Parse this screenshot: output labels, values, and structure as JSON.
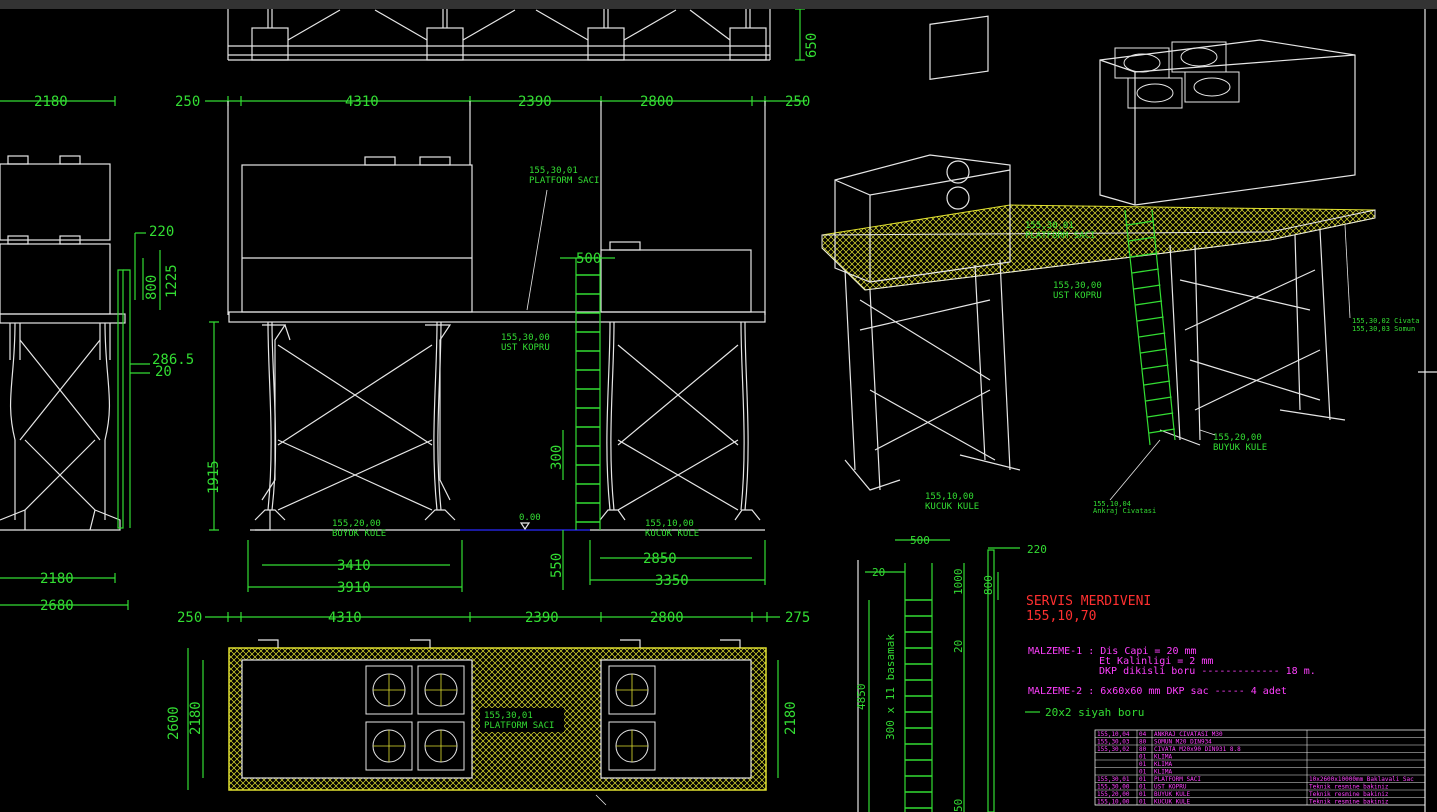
{
  "colors": {
    "background": "#000000",
    "lines": "#e6e6e6",
    "dimensions": "#33dd33",
    "hatch": "#e0e030",
    "title": "#ff3030",
    "materials": "#ff40ff",
    "groundline": "#2a2aff"
  },
  "top_view_partial": {
    "dim_650": "650"
  },
  "left_view": {
    "dim_top": "2180",
    "dim_220": "220",
    "dim_800": "800",
    "dim_1225": "1225",
    "dim_2865": "286.5",
    "dim_20": "20",
    "dim_bottom_2180": "2180",
    "dim_bottom_2680": "2680"
  },
  "front_view": {
    "dim_250_left": "250",
    "dim_4310": "4310",
    "dim_2390": "2390",
    "dim_2800": "2800",
    "dim_250_right": "250",
    "dim_500": "500",
    "dim_1915": "1915",
    "dim_300": "300",
    "dim_550": "550",
    "dim_3410": "3410",
    "dim_3910": "3910",
    "dim_2850": "2850",
    "dim_3350": "3350",
    "level_000": "0.00",
    "label_platform_code": "155,30,01",
    "label_platform_name": "PLATFORM SACI",
    "label_bridge_code": "155,30,00",
    "label_bridge_name": "UST KOPRU",
    "label_big_code": "155,20,00",
    "label_big_name": "BUYUK KULE",
    "label_small_code": "155,10,00",
    "label_small_name": "KUCUK KULE"
  },
  "plan_view": {
    "dim_250": "250",
    "dim_4310": "4310",
    "dim_2390": "2390",
    "dim_2800": "2800",
    "dim_275": "275",
    "dim_2600": "2600",
    "dim_2180_left": "2180",
    "dim_2180_right": "2180",
    "label_platform_code": "155,30,01",
    "label_platform_name": "PLATFORM SACI"
  },
  "iso_view": {
    "label_platform_code": "155,30,01",
    "label_platform_name": "PLATFORM SACI",
    "label_bridge_code": "155,30,00",
    "label_bridge_name": "UST KOPRU",
    "label_small_code": "155,10,00",
    "label_small_name": "KUCUK KULE",
    "label_big_code": "155,20,00",
    "label_big_name": "BUYUK KULE",
    "label_anchor_code": "155,10,04",
    "label_anchor_name": "Ankraj Civatasi",
    "label_bolt_codes": "155,30,02  Civata",
    "label_nut_codes": "155,30,03  Somun"
  },
  "ladder_detail": {
    "dim_500": "500",
    "dim_20_top": "20",
    "dim_220": "220",
    "dim_1000": "1000",
    "dim_800": "800",
    "dim_20_side": "20",
    "dim_4850": "4850",
    "dim_steps": "300 x 11 basamak",
    "dim_50": "50",
    "title": "SERVIS MERDIVENI",
    "code": "155,10,70",
    "material1_line1": "MALZEME-1 : Dis Capi = 20 mm",
    "material1_line2": "Et Kalinligi = 2 mm",
    "material1_line3": "DKP dikisli boru  ------------- 18 m.",
    "material2": "MALZEME-2 : 6x60x60 mm DKP sac  -----  4 adet",
    "pipe_note": "20x2 siyah boru"
  },
  "parts_table": {
    "rows": [
      {
        "code": "155,10,04",
        "qty": "04",
        "name": "ANKRAJ CIVATASI  M30",
        "note": ""
      },
      {
        "code": "155,30,03",
        "qty": "80",
        "name": "SOMUN  M20 DIN934",
        "note": ""
      },
      {
        "code": "155,30,02",
        "qty": "80",
        "name": "CIVATA  M20x90 DIN931 8.8",
        "note": ""
      },
      {
        "code": "",
        "qty": "01",
        "name": "KLIMA",
        "note": ""
      },
      {
        "code": "",
        "qty": "01",
        "name": "KLIMA",
        "note": ""
      },
      {
        "code": "",
        "qty": "01",
        "name": "KLIMA",
        "note": ""
      },
      {
        "code": "155,30,01",
        "qty": "01",
        "name": "PLATFORM SACI",
        "note": "10x2600x10000mm Baklavali Sac"
      },
      {
        "code": "155,30,00",
        "qty": "01",
        "name": "UST KOPRU",
        "note": "Teknik resmine bakiniz"
      },
      {
        "code": "155,20,00",
        "qty": "01",
        "name": "BUYUK KULE",
        "note": "Teknik resmine bakiniz"
      },
      {
        "code": "155,10,00",
        "qty": "01",
        "name": "KUCUK KULE",
        "note": "Teknik resmine bakiniz"
      }
    ]
  }
}
